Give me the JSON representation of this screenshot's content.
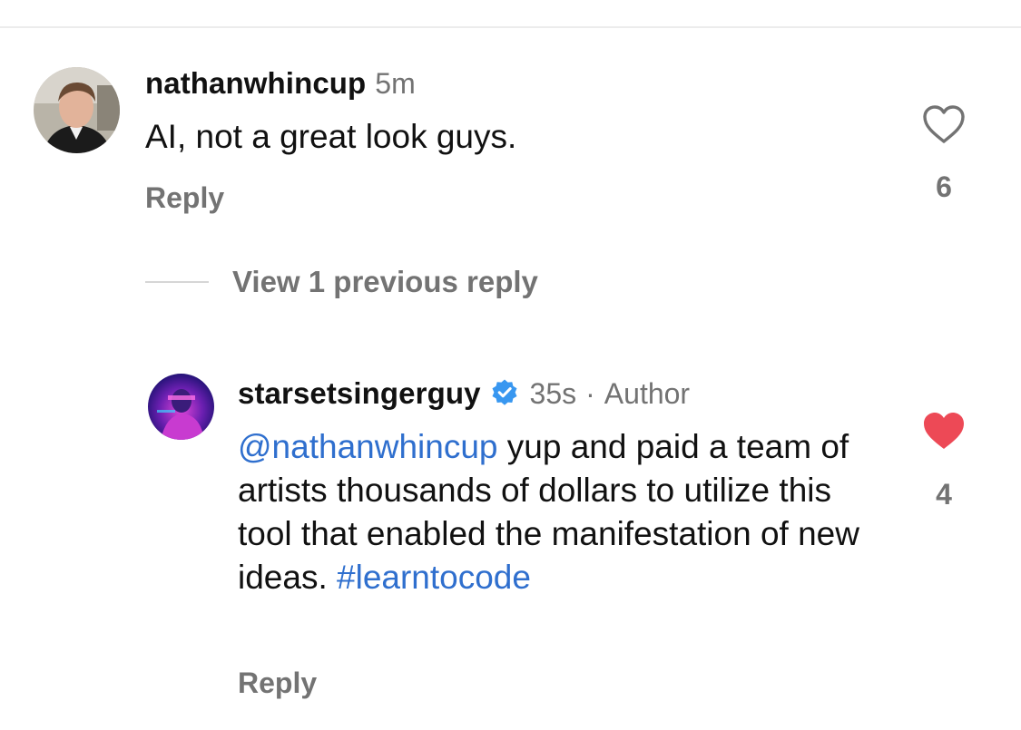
{
  "comment": {
    "username": "nathanwhincup",
    "timestamp": "5m",
    "text": "AI, not a great look guys.",
    "reply_label": "Reply",
    "like_count": "6",
    "liked": false,
    "avatar_icon": "user-avatar-photo"
  },
  "thread": {
    "view_replies_label": "View 1 previous reply"
  },
  "reply": {
    "username": "starsetsingerguy",
    "verified": true,
    "timestamp": "35s",
    "separator": "·",
    "author_label": "Author",
    "mention": "@nathanwhincup",
    "text": " yup and paid a team of artists thousands of dollars to utilize this tool that enabled the manifestation of new ideas. ",
    "hashtag": "#learntocode",
    "reply_label": "Reply",
    "like_count": "4",
    "liked": true,
    "avatar_icon": "user-avatar-photo"
  },
  "colors": {
    "link_blue": "#2f6fce",
    "like_red": "#ed4956",
    "verified_blue": "#3897f0",
    "muted_gray": "#737373"
  }
}
